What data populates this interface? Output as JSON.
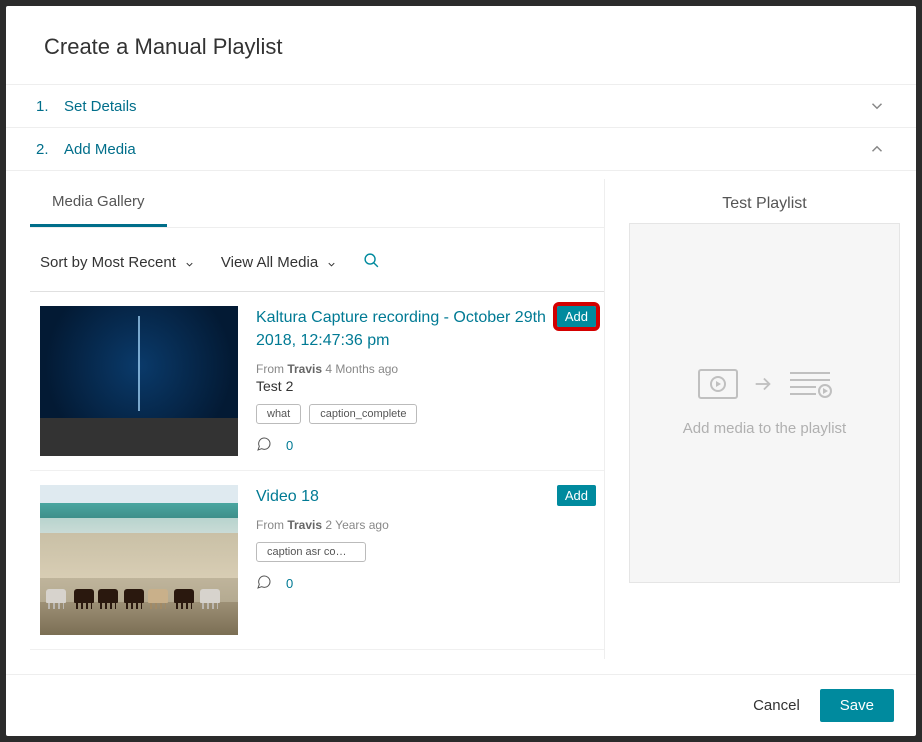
{
  "background_hint": "Media Gallery",
  "modal": {
    "title": "Create a Manual Playlist",
    "steps": {
      "s1_num": "1.",
      "s1_label": "Set Details",
      "s2_num": "2.",
      "s2_label": "Add Media"
    },
    "left_panel": {
      "tab": "Media Gallery",
      "sort_label": "Sort by Most Recent",
      "view_label": "View All Media"
    },
    "items": [
      {
        "title": "Kaltura Capture recording - October 29th 2018, 12:47:36 pm",
        "from_prefix": "From ",
        "author": "Travis",
        "age": " 4 Months ago",
        "description": "Test 2",
        "tags": [
          "what",
          "caption_complete"
        ],
        "comment_count": "0",
        "add_label": "Add"
      },
      {
        "title": "Video 18",
        "from_prefix": "From ",
        "author": "Travis",
        "age": " 2 Years ago",
        "description": "",
        "tags": [
          "caption asr comp…"
        ],
        "comment_count": "0",
        "add_label": "Add"
      }
    ],
    "playlist": {
      "title": "Test Playlist",
      "placeholder": "Add media to the playlist"
    },
    "footer": {
      "cancel": "Cancel",
      "save": "Save"
    }
  }
}
